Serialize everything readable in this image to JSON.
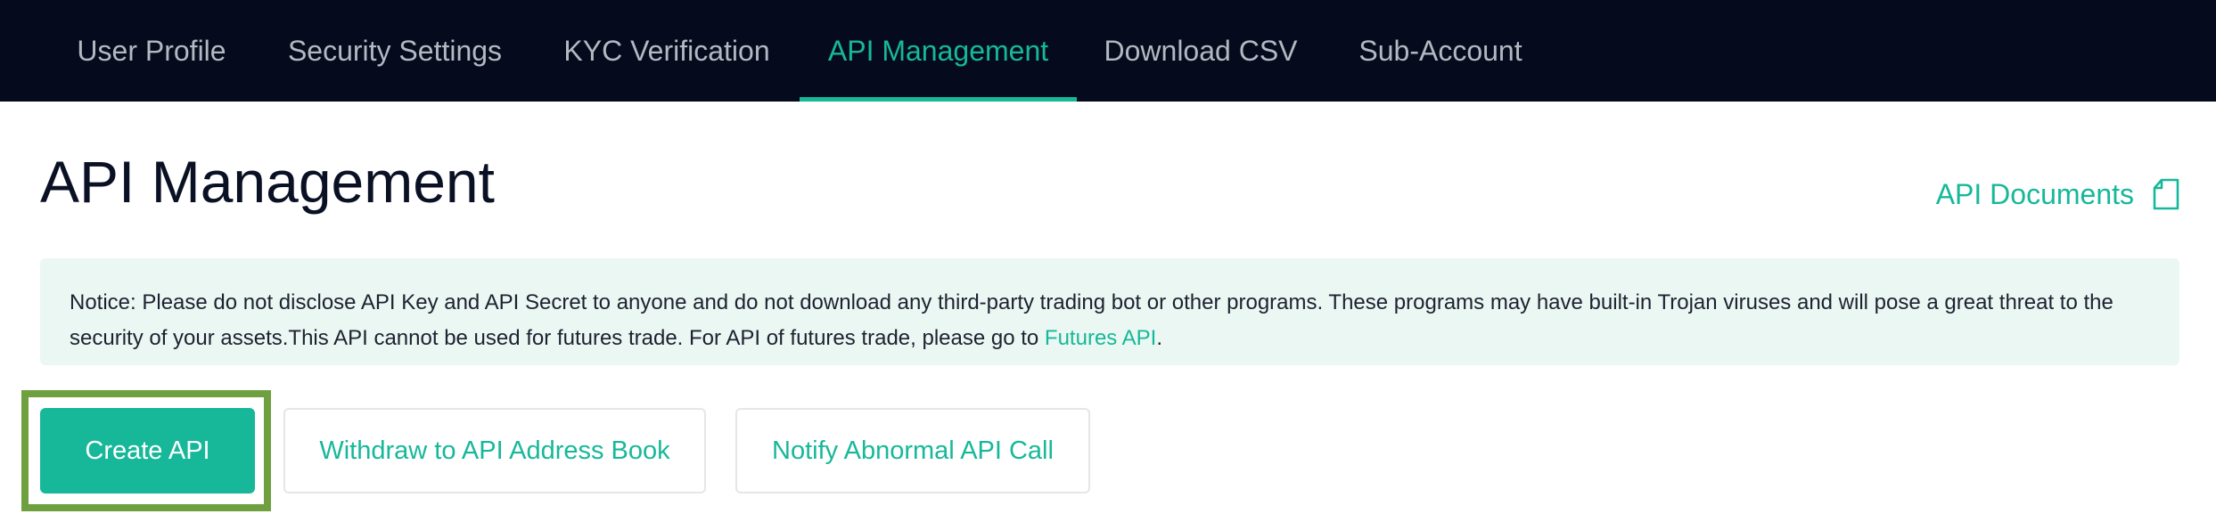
{
  "nav": {
    "tabs": [
      {
        "label": "User Profile"
      },
      {
        "label": "Security Settings"
      },
      {
        "label": "KYC Verification"
      },
      {
        "label": "API Management",
        "active": true
      },
      {
        "label": "Download CSV"
      },
      {
        "label": "Sub-Account"
      }
    ]
  },
  "page": {
    "title": "API Management",
    "api_docs_label": "API Documents",
    "api_docs_icon": "document-icon"
  },
  "notice": {
    "text": "Notice: Please do not disclose API Key and API Secret to anyone and do not download any third-party trading bot or other programs. These programs may have built-in Trojan viruses and will pose a great threat to the security of your assets.This API cannot be used for futures trade. For API of futures trade, please go to ",
    "link_label": "Futures API",
    "suffix": "."
  },
  "actions": {
    "create_label": "Create API",
    "withdraw_label": "Withdraw to API Address Book",
    "notify_label": "Notify Abnormal API Call"
  },
  "colors": {
    "nav_background": "#050b1c",
    "accent": "#17b89a",
    "notice_background": "#ebf7f3",
    "focus_ring": "#6fa040"
  }
}
